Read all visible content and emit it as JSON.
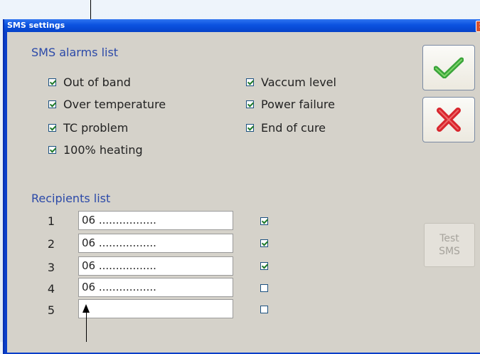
{
  "window": {
    "title": "SMS settings",
    "close_glyph": "×"
  },
  "alarms": {
    "title": "SMS alarms list",
    "items": [
      {
        "label": "Out of band",
        "checked": true
      },
      {
        "label": "Over temperature",
        "checked": true
      },
      {
        "label": "TC problem",
        "checked": true
      },
      {
        "label": "100% heating",
        "checked": true
      },
      {
        "label": "Vaccum level",
        "checked": true
      },
      {
        "label": "Power failure",
        "checked": true
      },
      {
        "label": "End of cure",
        "checked": true
      }
    ]
  },
  "recipients": {
    "title": "Recipients list",
    "rows": [
      {
        "num": "1",
        "value": "06 .................",
        "enabled": true
      },
      {
        "num": "2",
        "value": "06 .................",
        "enabled": true
      },
      {
        "num": "3",
        "value": "06 .................",
        "enabled": true
      },
      {
        "num": "4",
        "value": "06 .................",
        "enabled": false
      },
      {
        "num": "5",
        "value": "",
        "enabled": false
      }
    ]
  },
  "buttons": {
    "ok_icon": "check-icon",
    "cancel_icon": "cross-icon",
    "test_line1": "Test",
    "test_line2": "SMS"
  },
  "colors": {
    "title_bar": "#0b52e0",
    "section_title": "#2b49a8",
    "ok_green": "#3aa43a",
    "cancel_red": "#d8262e"
  }
}
